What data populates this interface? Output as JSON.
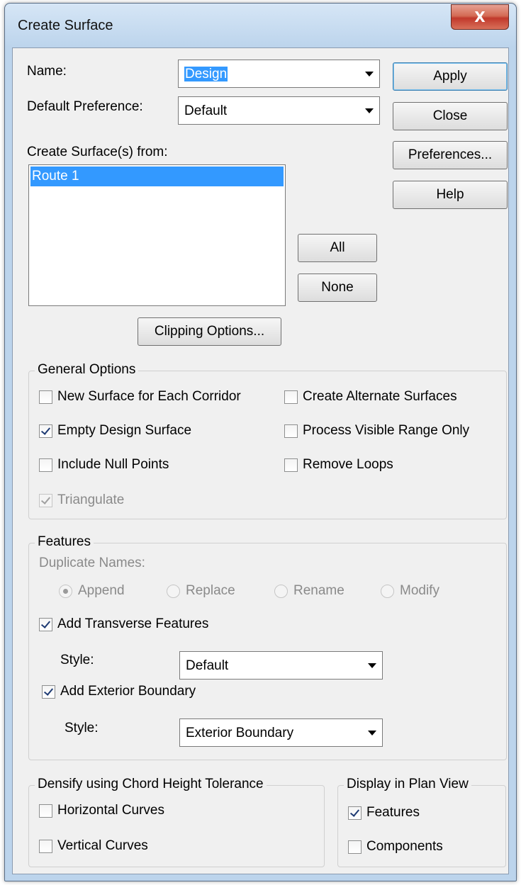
{
  "window": {
    "title": "Create Surface",
    "close_glyph": "X"
  },
  "name_field": {
    "label": "Name:",
    "value": "Design"
  },
  "default_preference": {
    "label": "Default Preference:",
    "value": "Default"
  },
  "source_list": {
    "label": "Create Surface(s) from:",
    "items": [
      "Route 1"
    ],
    "selected_index": 0
  },
  "buttons": {
    "apply": "Apply",
    "close": "Close",
    "preferences": "Preferences...",
    "help": "Help",
    "all": "All",
    "none": "None",
    "clipping": "Clipping Options..."
  },
  "general_options": {
    "title": "General Options",
    "new_surface_each_corridor": {
      "label": "New Surface for Each Corridor",
      "checked": false
    },
    "create_alternate_surfaces": {
      "label": "Create Alternate Surfaces",
      "checked": false
    },
    "empty_design_surface": {
      "label": "Empty Design Surface",
      "checked": true
    },
    "process_visible_range_only": {
      "label": "Process Visible Range Only",
      "checked": false
    },
    "include_null_points": {
      "label": "Include Null Points",
      "checked": false
    },
    "remove_loops": {
      "label": "Remove Loops",
      "checked": false
    },
    "triangulate": {
      "label": "Triangulate",
      "checked": true,
      "disabled": true
    }
  },
  "features": {
    "title": "Features",
    "duplicate_names_label": "Duplicate Names:",
    "duplicate_options": [
      "Append",
      "Replace",
      "Rename",
      "Modify"
    ],
    "duplicate_selected": "Append",
    "add_transverse": {
      "label": "Add Transverse Features",
      "checked": true
    },
    "transverse_style": {
      "label": "Style:",
      "value": "Default"
    },
    "add_exterior": {
      "label": "Add Exterior Boundary",
      "checked": true
    },
    "exterior_style": {
      "label": "Style:",
      "value": "Exterior Boundary"
    }
  },
  "densify": {
    "title": "Densify using Chord Height Tolerance",
    "horizontal": {
      "label": "Horizontal Curves",
      "checked": false
    },
    "vertical": {
      "label": "Vertical Curves",
      "checked": false
    }
  },
  "display_plan": {
    "title": "Display in Plan View",
    "features": {
      "label": "Features",
      "checked": true
    },
    "components": {
      "label": "Components",
      "checked": false
    }
  }
}
